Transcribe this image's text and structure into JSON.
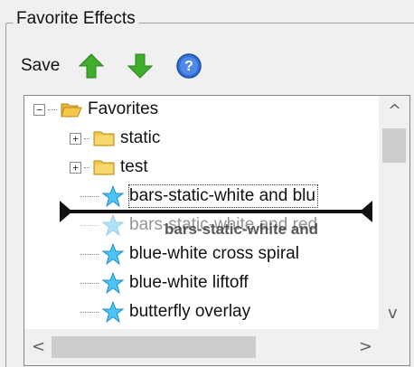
{
  "groupbox": {
    "title": "Favorite Effects"
  },
  "toolbar": {
    "save_label": "Save",
    "move_up_icon": "green-up-arrow-icon",
    "move_down_icon": "green-down-arrow-icon",
    "help_icon": "blue-help-icon"
  },
  "tree": {
    "root": {
      "label": "Favorites",
      "expander": "−"
    },
    "folders": [
      {
        "label": "static",
        "expander": "+"
      },
      {
        "label": "test",
        "expander": "+"
      }
    ],
    "effects": [
      {
        "label": "bars-static-white and blu"
      },
      {
        "label": "bars-static-white and red"
      },
      {
        "label": "blue-white cross spiral"
      },
      {
        "label": "blue-white liftoff"
      },
      {
        "label": "butterfly overlay"
      }
    ],
    "drag_ghost_label": "bars-static-white and"
  },
  "scrollbars": {
    "vertical_up": "^",
    "vertical_down": "v",
    "horizontal_left": "<",
    "horizontal_right": ">"
  },
  "colors": {
    "folder": "#f4c84b",
    "star": "#4fc3f7",
    "arrow_green": "#3fae2a",
    "help_blue": "#2f6fd6"
  }
}
